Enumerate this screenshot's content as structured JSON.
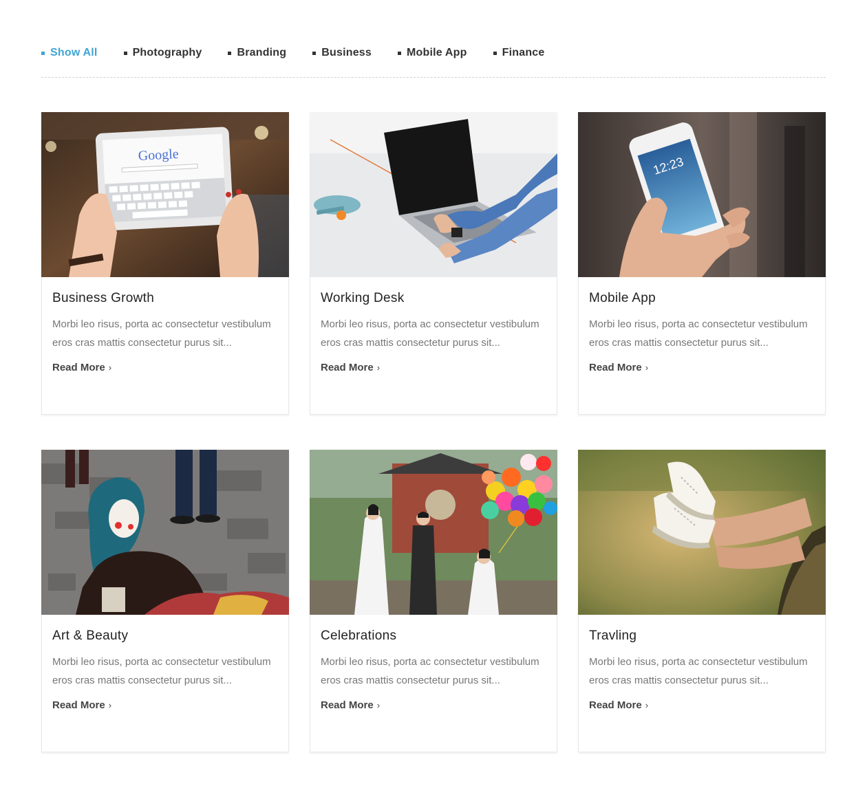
{
  "filters": [
    {
      "label": "Show All",
      "active": true
    },
    {
      "label": "Photography",
      "active": false
    },
    {
      "label": "Branding",
      "active": false
    },
    {
      "label": "Business",
      "active": false
    },
    {
      "label": "Mobile App",
      "active": false
    },
    {
      "label": "Finance",
      "active": false
    }
  ],
  "accent_color": "#3fa4d6",
  "cards": [
    {
      "title": "Business Growth",
      "excerpt": "Morbi leo risus, porta ac consectetur vestibulum eros cras mattis consectetur purus sit...",
      "link": "Read More",
      "image_text": "Google"
    },
    {
      "title": "Working Desk",
      "excerpt": "Morbi leo risus, porta ac consectetur vestibulum eros cras mattis consectetur purus sit...",
      "link": "Read More"
    },
    {
      "title": "Mobile App",
      "excerpt": "Morbi leo risus, porta ac consectetur vestibulum eros cras mattis consectetur purus sit...",
      "link": "Read More",
      "image_text": "12:23"
    },
    {
      "title": "Art & Beauty",
      "excerpt": "Morbi leo risus, porta ac consectetur vestibulum eros cras mattis consectetur purus sit...",
      "link": "Read More"
    },
    {
      "title": "Celebrations",
      "excerpt": "Morbi leo risus, porta ac consectetur vestibulum eros cras mattis consectetur purus sit...",
      "link": "Read More"
    },
    {
      "title": "Travling",
      "excerpt": "Morbi leo risus, porta ac consectetur vestibulum eros cras mattis consectetur purus sit...",
      "link": "Read More"
    }
  ],
  "icons": {
    "bullet": "square-bullet-icon",
    "read_more": "chevron-right-icon"
  },
  "link_chevron": "›"
}
